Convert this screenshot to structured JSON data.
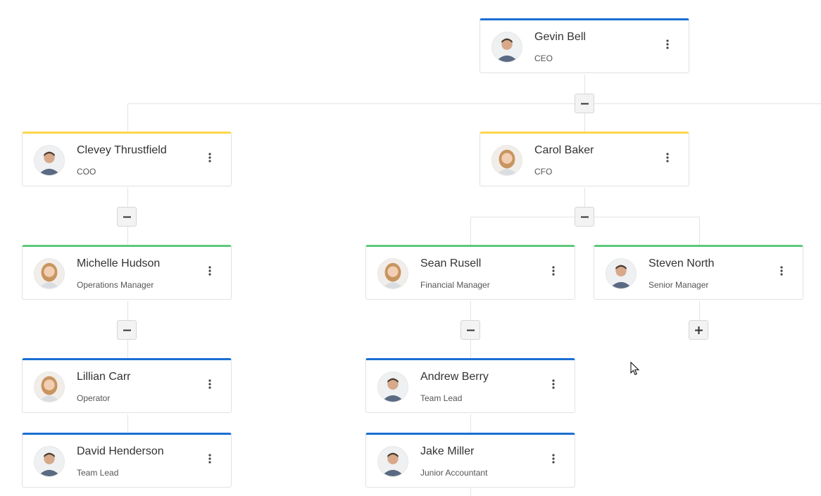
{
  "colors": {
    "executive": "#1b6fd1",
    "c_level": "#ffd54f",
    "manager": "#5cc97b",
    "staff": "#1b6fd1"
  },
  "org_chart": {
    "nodes": [
      {
        "id": "gevin",
        "name": "Gevin Bell",
        "title": "CEO",
        "level": "executive",
        "toggle": "minus",
        "avatar": "man-photo"
      },
      {
        "id": "clevey",
        "name": "Clevey Thrustfield",
        "title": "COO",
        "level": "c_level",
        "toggle": "minus",
        "avatar": "man-photo"
      },
      {
        "id": "carol",
        "name": "Carol Baker",
        "title": "CFO",
        "level": "c_level",
        "toggle": "minus",
        "avatar": "woman-photo"
      },
      {
        "id": "michelle",
        "name": "Michelle Hudson",
        "title": "Operations Manager",
        "level": "manager",
        "toggle": "minus",
        "avatar": "woman-photo"
      },
      {
        "id": "sean",
        "name": "Sean Rusell",
        "title": "Financial Manager",
        "level": "manager",
        "toggle": "minus",
        "avatar": "woman-photo"
      },
      {
        "id": "steven",
        "name": "Steven North",
        "title": "Senior Manager",
        "level": "manager",
        "toggle": "plus",
        "avatar": "man-photo"
      },
      {
        "id": "lillian",
        "name": "Lillian Carr",
        "title": "Operator",
        "level": "staff",
        "toggle": null,
        "avatar": "woman-photo"
      },
      {
        "id": "david",
        "name": "David Henderson",
        "title": "Team Lead",
        "level": "staff",
        "toggle": null,
        "avatar": "man-photo"
      },
      {
        "id": "andrew",
        "name": "Andrew Berry",
        "title": "Team Lead",
        "level": "staff",
        "toggle": null,
        "avatar": "man-photo"
      },
      {
        "id": "jake",
        "name": "Jake Miller",
        "title": "Junior Accountant",
        "level": "staff",
        "toggle": null,
        "avatar": "man-photo"
      }
    ],
    "icons": {
      "menu": "more-vertical-icon",
      "collapse": "minus-icon",
      "expand": "plus-icon",
      "cursor": "mouse-cursor-icon"
    }
  }
}
